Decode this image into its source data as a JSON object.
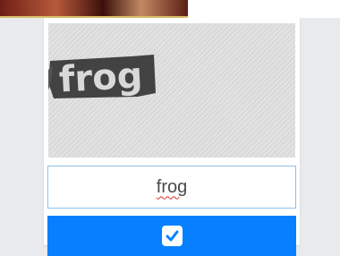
{
  "captcha": {
    "word": "frog"
  },
  "answer": {
    "value": "frog"
  },
  "submit": {
    "icon": "check-icon",
    "color": "#0780ff"
  }
}
